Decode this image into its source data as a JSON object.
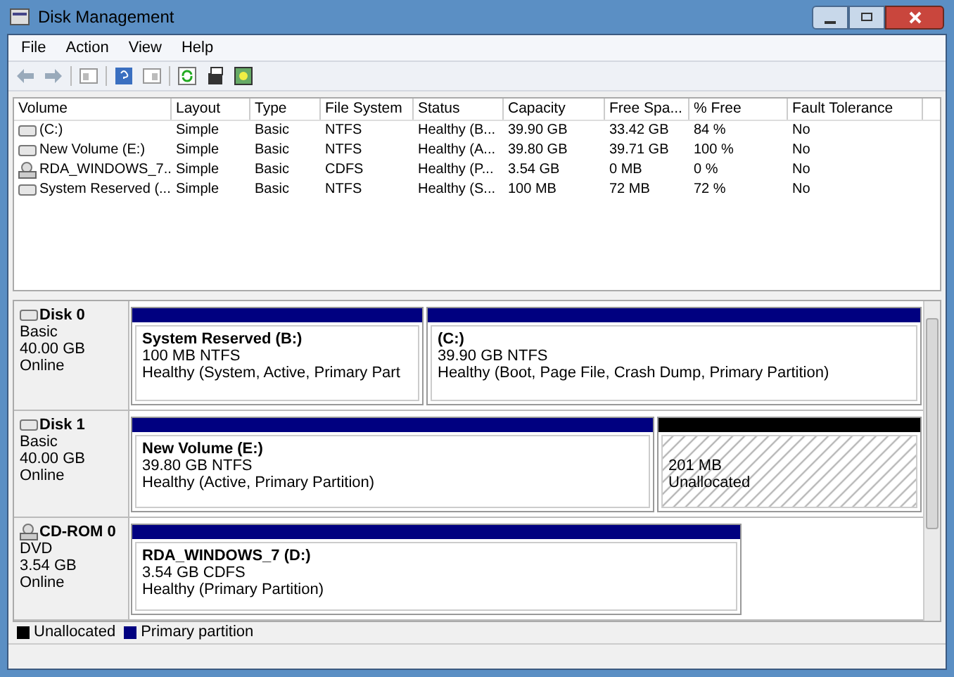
{
  "window": {
    "title": "Disk Management"
  },
  "menu": [
    "File",
    "Action",
    "View",
    "Help"
  ],
  "volumes": {
    "columns": [
      "Volume",
      "Layout",
      "Type",
      "File System",
      "Status",
      "Capacity",
      "Free Spa...",
      "% Free",
      "Fault Tolerance"
    ],
    "rows": [
      {
        "kind": "disk",
        "cells": [
          "(C:)",
          "Simple",
          "Basic",
          "NTFS",
          "Healthy (B...",
          "39.90 GB",
          "33.42 GB",
          "84 %",
          "No"
        ]
      },
      {
        "kind": "disk",
        "cells": [
          "New Volume (E:)",
          "Simple",
          "Basic",
          "NTFS",
          "Healthy (A...",
          "39.80 GB",
          "39.71 GB",
          "100 %",
          "No"
        ]
      },
      {
        "kind": "cdrom",
        "cells": [
          "RDA_WINDOWS_7...",
          "Simple",
          "Basic",
          "CDFS",
          "Healthy (P...",
          "3.54 GB",
          "0 MB",
          "0 %",
          "No"
        ]
      },
      {
        "kind": "disk",
        "cells": [
          "System Reserved (...",
          "Simple",
          "Basic",
          "NTFS",
          "Healthy (S...",
          "100 MB",
          "72 MB",
          "72 %",
          "No"
        ]
      }
    ]
  },
  "disks": [
    {
      "kind": "disk",
      "name": "Disk 0",
      "type": "Basic",
      "size": "40.00 GB",
      "state": "Online",
      "partitions": [
        {
          "kind": "primary",
          "name": "System Reserved  (B:)",
          "size": "100 MB NTFS",
          "status": "Healthy (System, Active, Primary Part"
        },
        {
          "kind": "primary",
          "name": "(C:)",
          "size": "39.90 GB NTFS",
          "status": "Healthy (Boot, Page File, Crash Dump, Primary Partition)"
        }
      ]
    },
    {
      "kind": "disk",
      "name": "Disk 1",
      "type": "Basic",
      "size": "40.00 GB",
      "state": "Online",
      "partitions": [
        {
          "kind": "primary",
          "name": "New Volume  (E:)",
          "size": "39.80 GB NTFS",
          "status": "Healthy (Active, Primary Partition)"
        },
        {
          "kind": "unallocated",
          "size": "201 MB",
          "status": "Unallocated"
        }
      ]
    },
    {
      "kind": "cdrom",
      "name": "CD-ROM 0",
      "type": "DVD",
      "size": "3.54 GB",
      "state": "Online",
      "partitions": [
        {
          "kind": "primary",
          "name": "RDA_WINDOWS_7  (D:)",
          "size": "3.54 GB CDFS",
          "status": "Healthy (Primary Partition)"
        }
      ]
    }
  ],
  "legend": [
    {
      "label": "Unallocated",
      "color": "#000000"
    },
    {
      "label": "Primary partition",
      "color": "#000080"
    }
  ]
}
